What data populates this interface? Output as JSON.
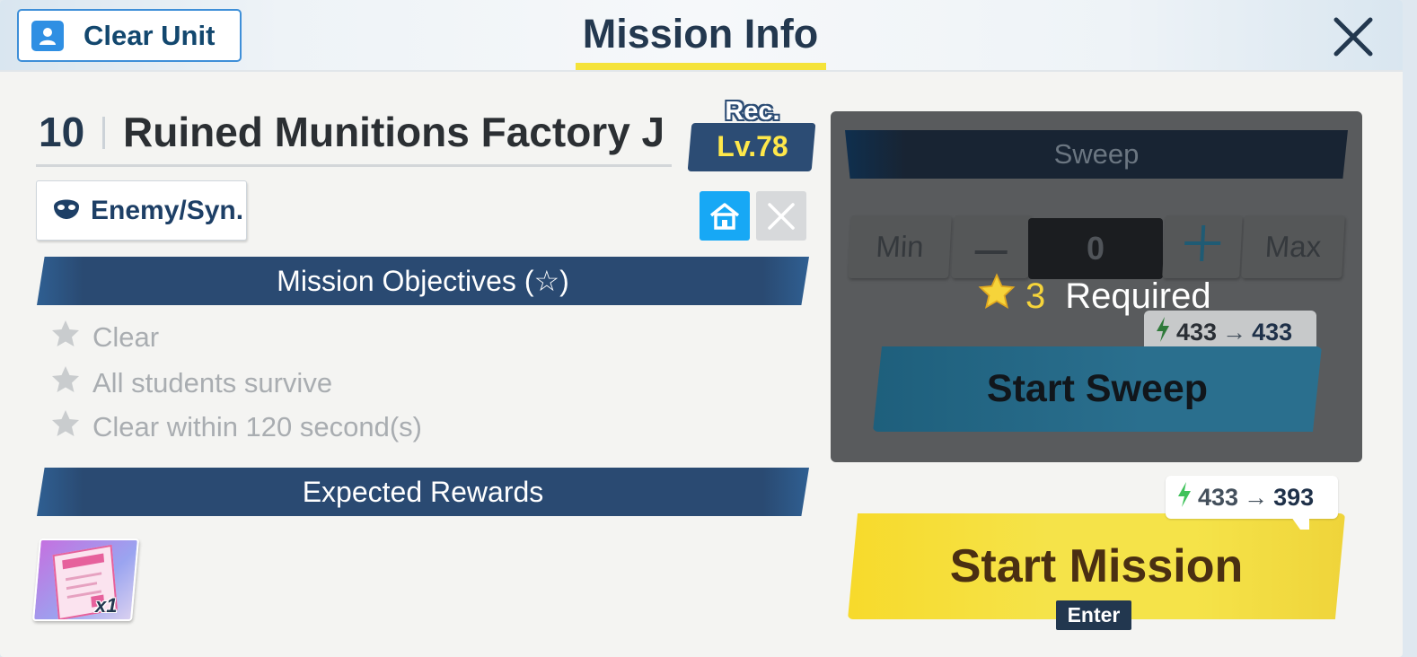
{
  "header": {
    "clear_unit_label": "Clear Unit",
    "title": "Mission Info"
  },
  "stage": {
    "number": "10",
    "name": "Ruined Munitions Factory J",
    "rec_label": "Rec.",
    "rec_level": "Lv.78",
    "enemy_tag": "Enemy/Syn."
  },
  "objectives": {
    "heading": "Mission Objectives (☆)",
    "items": [
      "Clear",
      "All students survive",
      "Clear within 120 second(s)"
    ]
  },
  "rewards": {
    "heading": "Expected Rewards",
    "items": [
      {
        "quantity": "x1"
      }
    ]
  },
  "sweep": {
    "header": "Sweep",
    "min_label": "Min",
    "minus_label": "—",
    "count": "0",
    "plus_label": "+",
    "max_label": "Max",
    "required_count": "3",
    "required_label": "Required",
    "ap_from": "433",
    "ap_to": "433",
    "start_label": "Start Sweep"
  },
  "mission": {
    "ap_from": "433",
    "ap_to": "393",
    "start_label": "Start Mission",
    "enter_key": "Enter"
  },
  "colors": {
    "accent_yellow": "#f5e349",
    "navy": "#2a4a72",
    "blue": "#17a8f5"
  }
}
